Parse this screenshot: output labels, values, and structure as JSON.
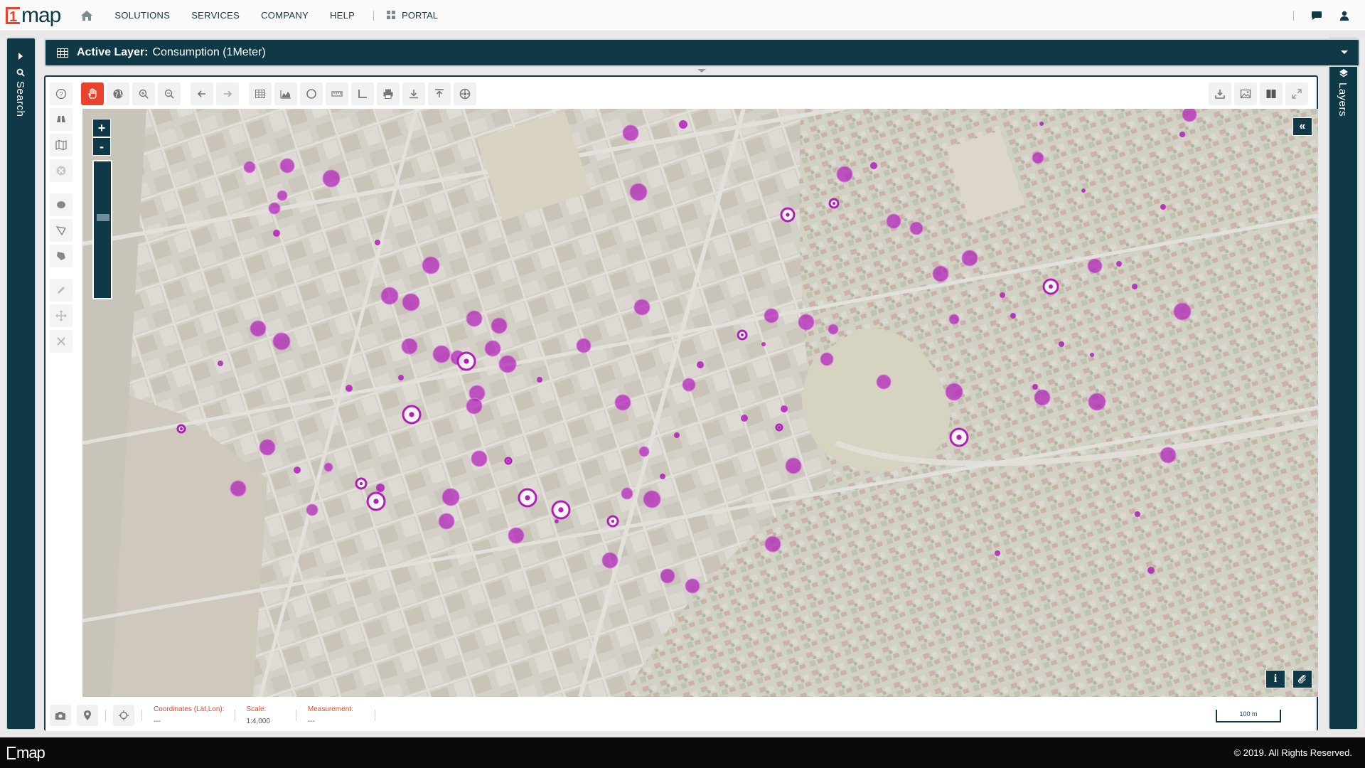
{
  "brand": {
    "logo_digit": "1",
    "logo_text": "map",
    "accent": "#e8432d",
    "dark": "#0f3947"
  },
  "nav": {
    "home_icon": "home-icon",
    "items": [
      "SOLUTIONS",
      "SERVICES",
      "COMPANY",
      "HELP"
    ],
    "portal": "PORTAL"
  },
  "panels": {
    "left_label": "Search",
    "right_label": "Layers"
  },
  "active_layer": {
    "label": "Active Layer:",
    "value": "Consumption (1Meter)"
  },
  "toolbar": {
    "left_tools": [
      "help-icon",
      "pan-hand-icon",
      "globe-icon",
      "zoom-in-icon",
      "zoom-out-icon",
      "back-arrow-icon",
      "forward-arrow-icon",
      "table-icon",
      "chart-icon",
      "circle-icon",
      "ruler-icon",
      "angle-icon",
      "print-icon",
      "download-icon",
      "upload-icon",
      "settings-icon"
    ],
    "right_tools": [
      "export-icon",
      "image-icon",
      "columns-icon",
      "fullscreen-icon"
    ],
    "vertical_tools": [
      "binoculars-icon",
      "map-icon",
      "clear-icon",
      "polygon-circle-icon",
      "polygon-icon",
      "fill-icon",
      "edit-icon",
      "move-icon",
      "delete-icon"
    ]
  },
  "map": {
    "zoom_in": "+",
    "zoom_out": "-",
    "collapse": "«",
    "info": "i",
    "point_color": "#b01fb8"
  },
  "status": {
    "coords_label": "Coordinates (Lat,Lon):",
    "coords_value": "---",
    "scale_label": "Scale:",
    "scale_value": "1:4,000",
    "measure_label": "Measurement:",
    "measure_value": "---",
    "scalebar": "100 m"
  },
  "footer": {
    "logo_digit": "1",
    "logo_text": "map",
    "copyright": "© 2019. All Rights Reserved."
  }
}
